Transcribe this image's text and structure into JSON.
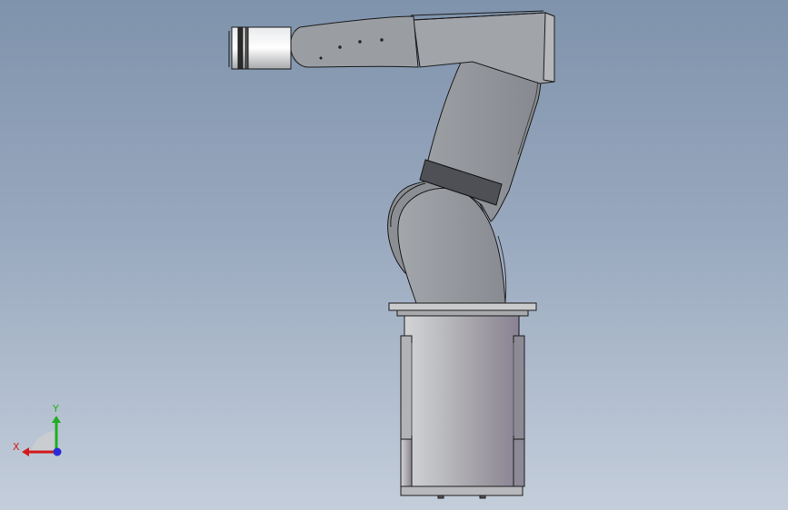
{
  "viewport": {
    "background_top": "#7f93ac",
    "background_bottom": "#c4cedb"
  },
  "model": {
    "part_color": "#8f9299",
    "edge_color": "#1b1b1b"
  },
  "triad": {
    "x_label": "X",
    "y_label": "Y",
    "x_color": "#d21b1b",
    "y_color": "#1fae1f",
    "z_color": "#2a2ad6"
  }
}
